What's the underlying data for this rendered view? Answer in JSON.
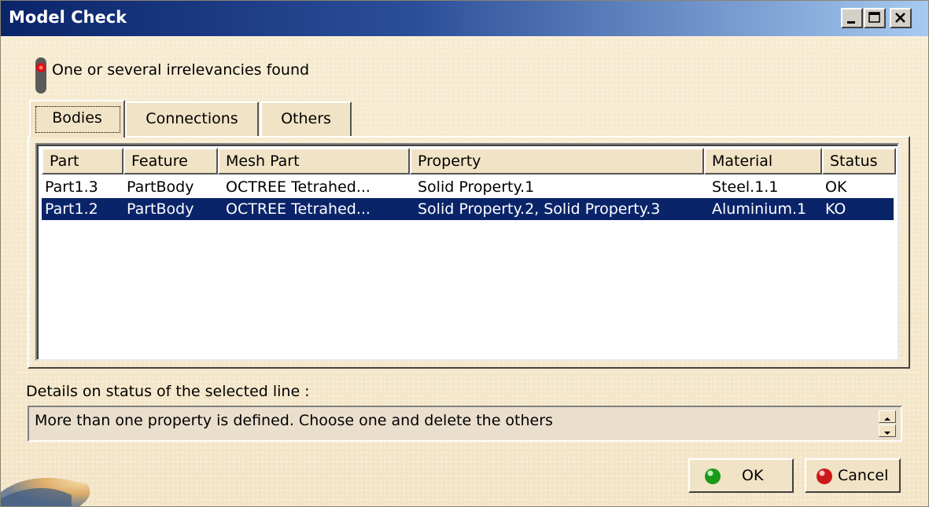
{
  "window": {
    "title": "Model Check"
  },
  "status": {
    "message": "One or several irrelevancies found",
    "indicator_color": "#cc0000"
  },
  "tabs": [
    {
      "label": "Bodies",
      "active": true
    },
    {
      "label": "Connections",
      "active": false
    },
    {
      "label": "Others",
      "active": false
    }
  ],
  "table": {
    "columns": [
      "Part",
      "Feature",
      "Mesh Part",
      "Property",
      "Material",
      "Status"
    ],
    "rows": [
      [
        "Part1.3",
        "PartBody",
        "OCTREE Tetrahed...",
        "Solid Property.1",
        "Steel.1.1",
        "OK"
      ],
      [
        "Part1.2",
        "PartBody",
        "OCTREE Tetrahed...",
        "Solid Property.2, Solid Property.3",
        "Aluminium.1",
        "KO"
      ]
    ],
    "selected_row": 1,
    "selection_color": "#0a246a"
  },
  "details": {
    "label": "Details on status of the selected line :",
    "text": "More than one property is defined. Choose one and delete the others"
  },
  "buttons": {
    "ok_label": "OK",
    "cancel_label": "Cancel",
    "ok_icon_color": "#1a9a1a",
    "cancel_icon_color": "#cc1a1a"
  }
}
